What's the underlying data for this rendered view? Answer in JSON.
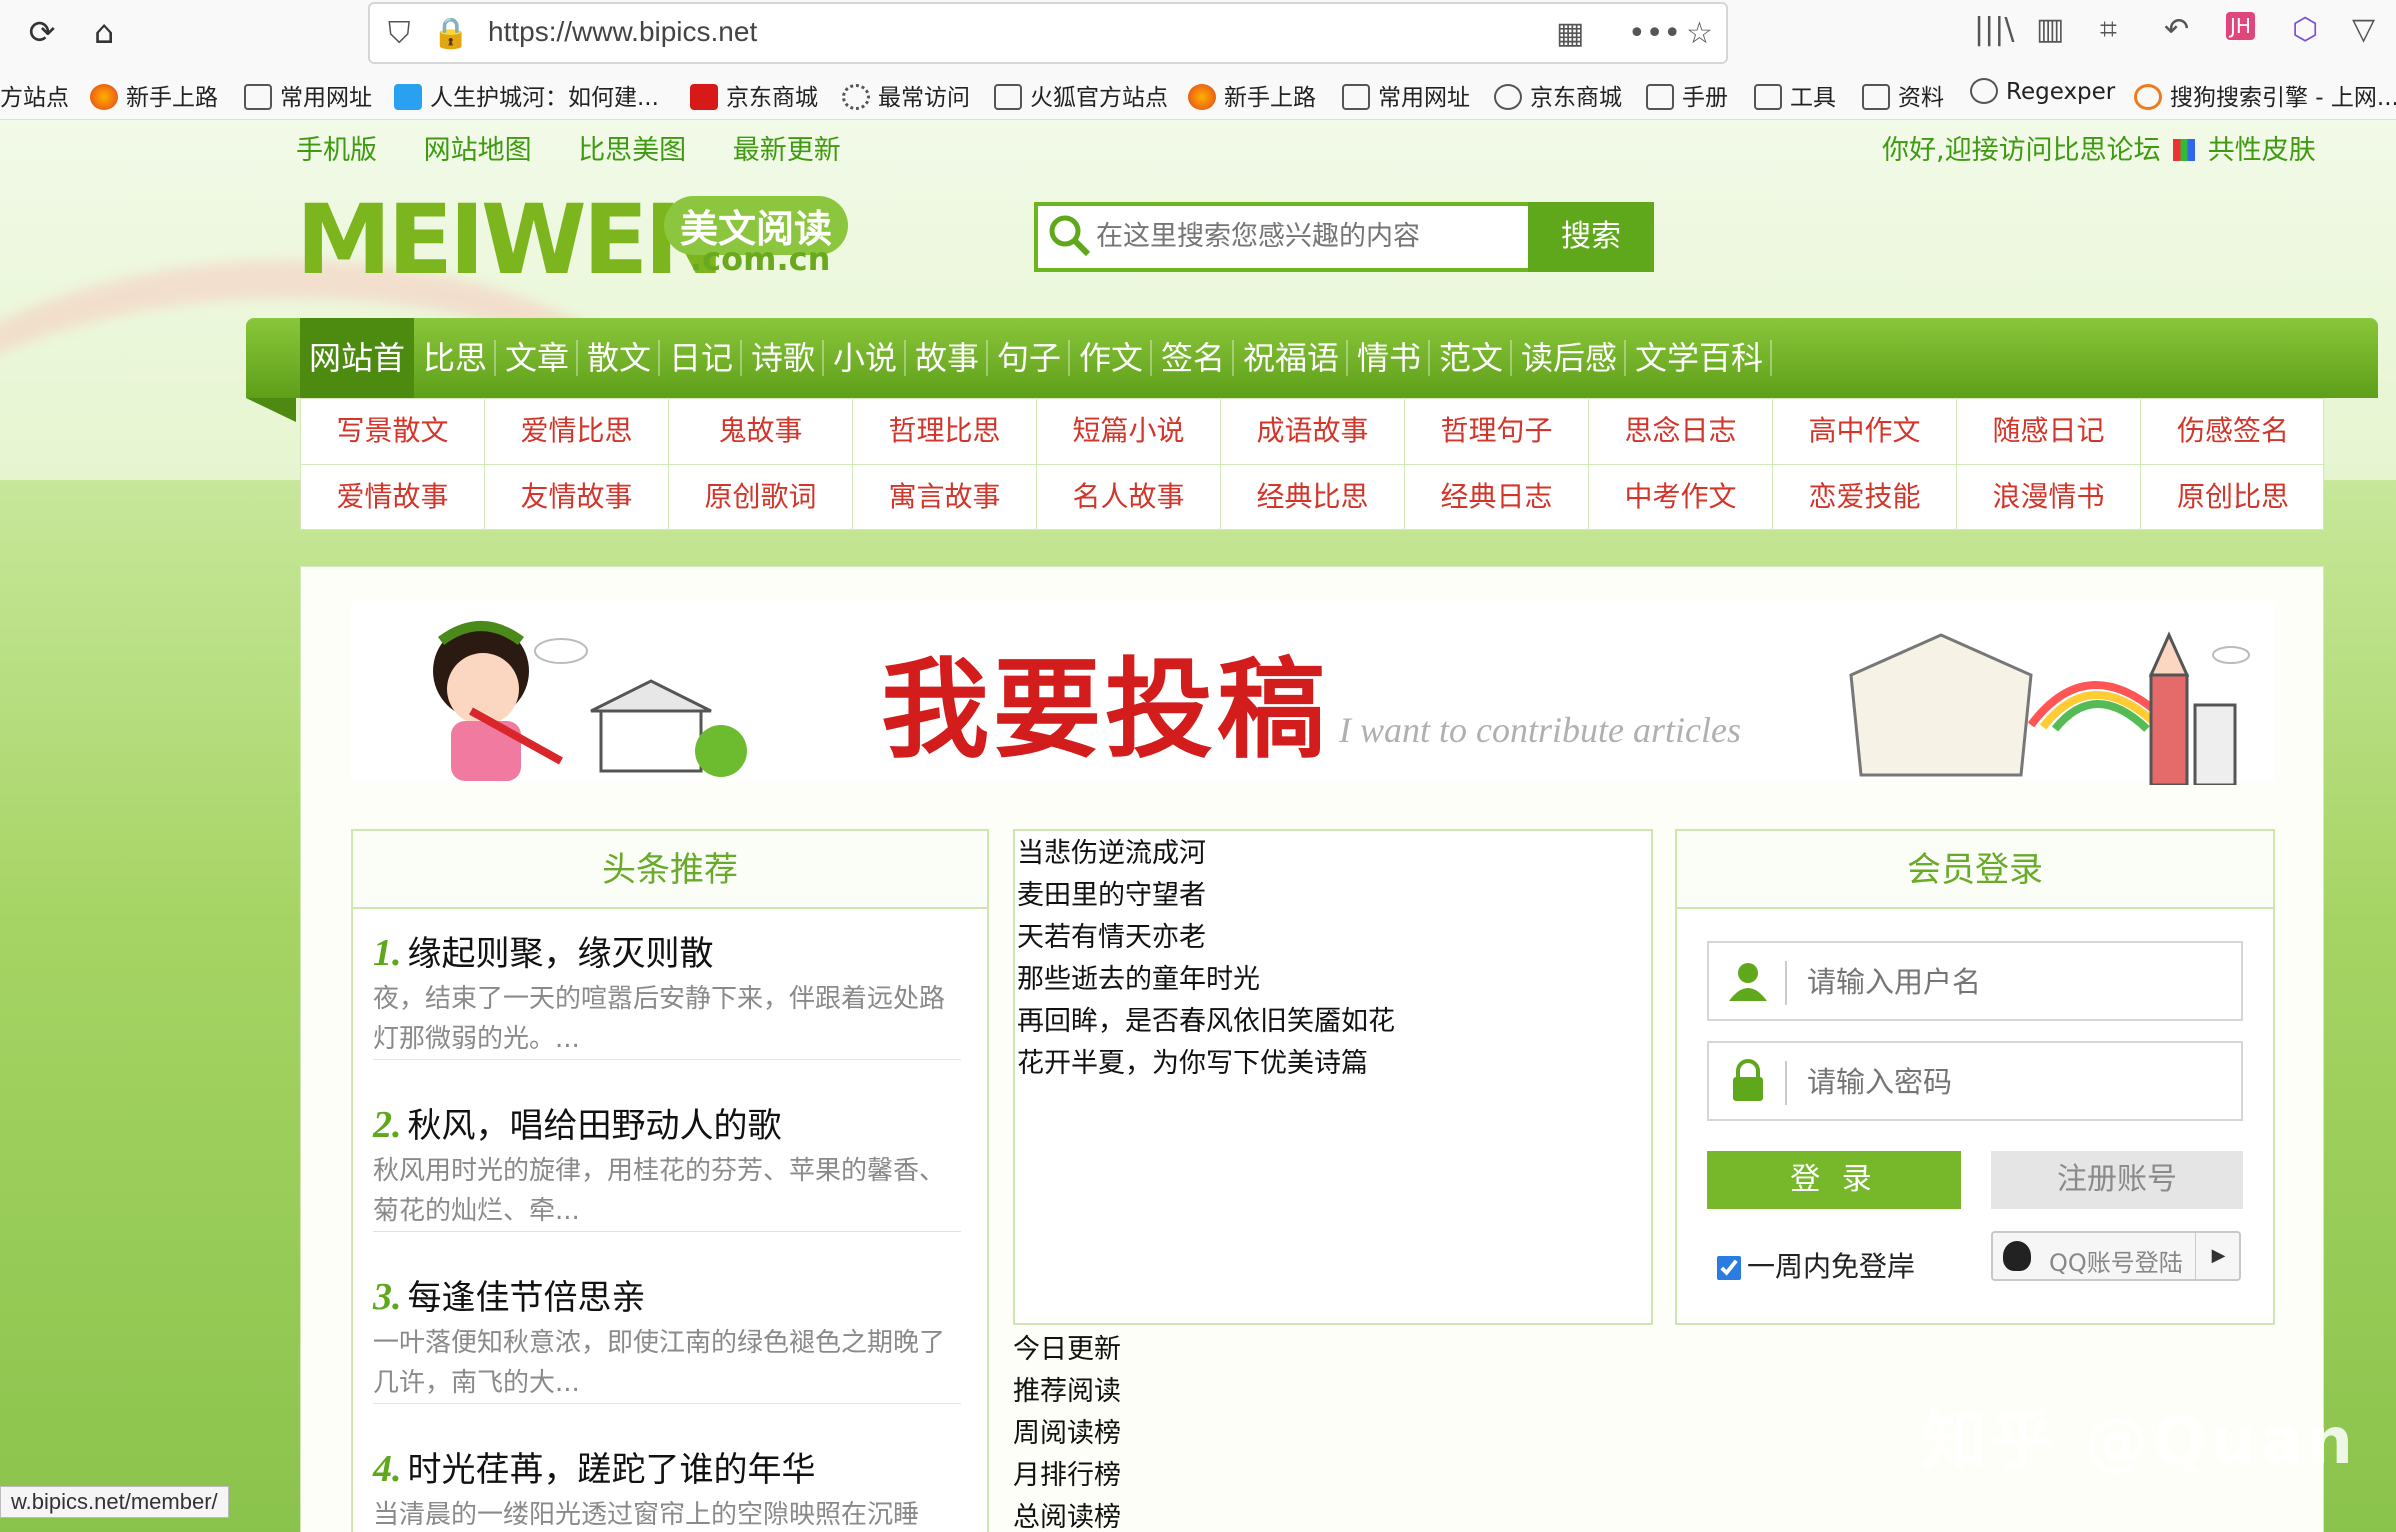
{
  "browser": {
    "url": "https://www.bipics.net",
    "status_link": "w.bipics.net/member/",
    "bookmarks": [
      {
        "label": "方站点",
        "icon": "folder-icon"
      },
      {
        "label": "新手上路",
        "icon": "firefox-icon"
      },
      {
        "label": "常用网址",
        "icon": "folder-icon"
      },
      {
        "label": "人生护城河：如何建...",
        "icon": "blue-square-icon"
      },
      {
        "label": "京东商城",
        "icon": "jd-icon"
      },
      {
        "label": "最常访问",
        "icon": "gear-icon"
      },
      {
        "label": "火狐官方站点",
        "icon": "folder-icon"
      },
      {
        "label": "新手上路",
        "icon": "firefox-icon"
      },
      {
        "label": "常用网址",
        "icon": "folder-icon"
      },
      {
        "label": "京东商城",
        "icon": "globe-icon"
      },
      {
        "label": "手册",
        "icon": "folder-icon"
      },
      {
        "label": "工具",
        "icon": "folder-icon"
      },
      {
        "label": "资料",
        "icon": "folder-icon"
      },
      {
        "label": "Regexper",
        "icon": "globe-icon"
      },
      {
        "label": "搜狗搜索引擎 - 上网...",
        "icon": "sogou-icon"
      }
    ]
  },
  "site": {
    "top_links": [
      "手机版",
      "网站地图",
      "比思美图",
      "最新更新"
    ],
    "welcome": "你好,迎接访问比思论坛",
    "skin": "共性皮肤",
    "logo_text": "MEIWEN",
    "logo_badge": "美文阅读",
    "logo_domain": ".com.cn",
    "search_placeholder": "在这里搜索您感兴趣的内容",
    "search_button": "搜索",
    "main_nav": [
      "网站首页",
      "比思",
      "文章",
      "散文",
      "日记",
      "诗歌",
      "小说",
      "故事",
      "句子",
      "作文",
      "签名",
      "祝福语",
      "情书",
      "范文",
      "读后感",
      "文学百科"
    ],
    "sub_nav_row1": [
      "写景散文",
      "爱情比思",
      "鬼故事",
      "哲理比思",
      "短篇小说",
      "成语故事",
      "哲理句子",
      "思念日志",
      "高中作文",
      "随感日记",
      "伤感签名"
    ],
    "sub_nav_row2": [
      "爱情故事",
      "友情故事",
      "原创歌词",
      "寓言故事",
      "名人故事",
      "经典比思",
      "经典日志",
      "中考作文",
      "恋爱技能",
      "浪漫情书",
      "原创比思"
    ],
    "banner_title": "我要投稿",
    "banner_sub": "I want to contribute articles",
    "headline_title": "头条推荐",
    "headlines": [
      {
        "num": "1.",
        "title": "缘起则聚，缘灭则散",
        "desc": "夜，结束了一天的喧嚣后安静下来，伴跟着远处路灯那微弱的光。..."
      },
      {
        "num": "2.",
        "title": "秋风，唱给田野动人的歌",
        "desc": "秋风用时光的旋律，用桂花的芬芳、苹果的馨香、菊花的灿烂、牵..."
      },
      {
        "num": "3.",
        "title": "每逢佳节倍思亲",
        "desc": "一叶落便知秋意浓，即使江南的绿色褪色之期晚了几许，南飞的大..."
      },
      {
        "num": "4.",
        "title": "时光荏苒，蹉跎了谁的年华",
        "desc": "当清晨的一缕阳光透过窗帘上的空隙映照在沉睡"
      }
    ],
    "mid_links": [
      "当悲伤逆流成河",
      "麦田里的守望者",
      "天若有情天亦老",
      "那些逝去的童年时光",
      "再回眸，是否春风依旧笑靥如花",
      "花开半夏，为你写下优美诗篇"
    ],
    "mid_list": [
      "今日更新",
      "推荐阅读",
      "周阅读榜",
      "月排行榜",
      "总阅读榜"
    ],
    "login_title": "会员登录",
    "username_placeholder": "请输入用户名",
    "password_placeholder": "请输入密码",
    "login_button": "登 录",
    "register_button": "注册账号",
    "remember_label": "一周内免登岸",
    "qq_login": "QQ账号登陆"
  },
  "watermark": "知乎 @Quan",
  "colors": {
    "brand_green": "#5fa71b",
    "nav_active": "#4c8a10",
    "subnav_red": "#d2362b",
    "banner_red": "#d31d1d"
  }
}
